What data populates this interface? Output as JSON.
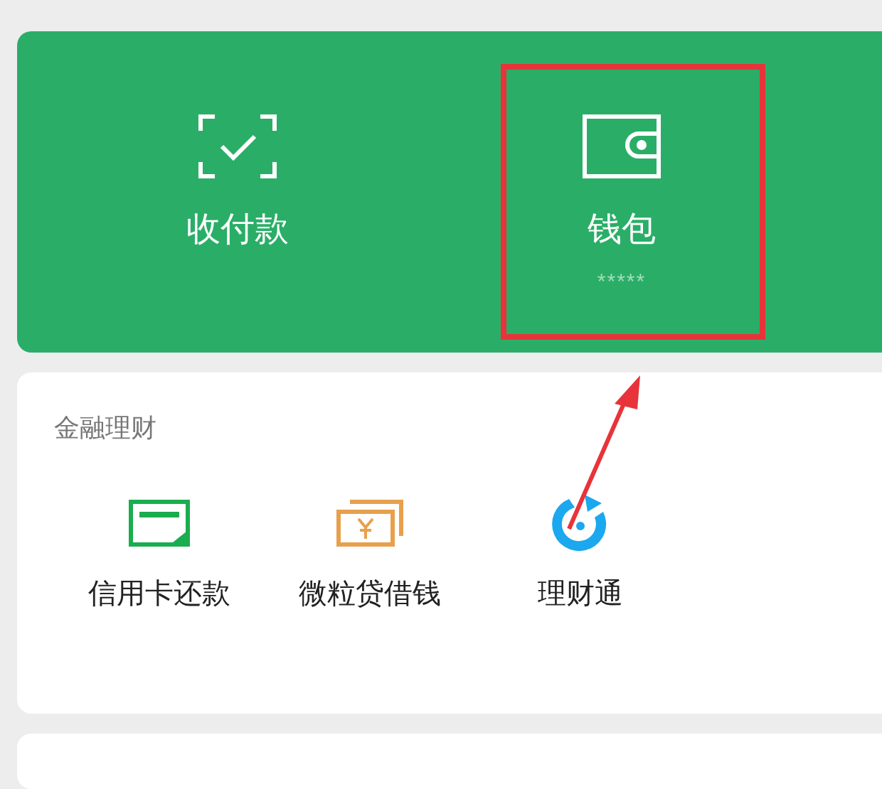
{
  "top_card": {
    "items": [
      {
        "kind": "scan",
        "label": "收付款",
        "highlighted": false
      },
      {
        "kind": "wallet",
        "label": "钱包",
        "balance": "*****",
        "highlighted": true
      }
    ]
  },
  "finance": {
    "title": "金融理财",
    "items": [
      {
        "kind": "card",
        "label": "信用卡还款"
      },
      {
        "kind": "cash",
        "label": "微粒贷借钱"
      },
      {
        "kind": "fund",
        "label": "理财通"
      }
    ]
  }
}
